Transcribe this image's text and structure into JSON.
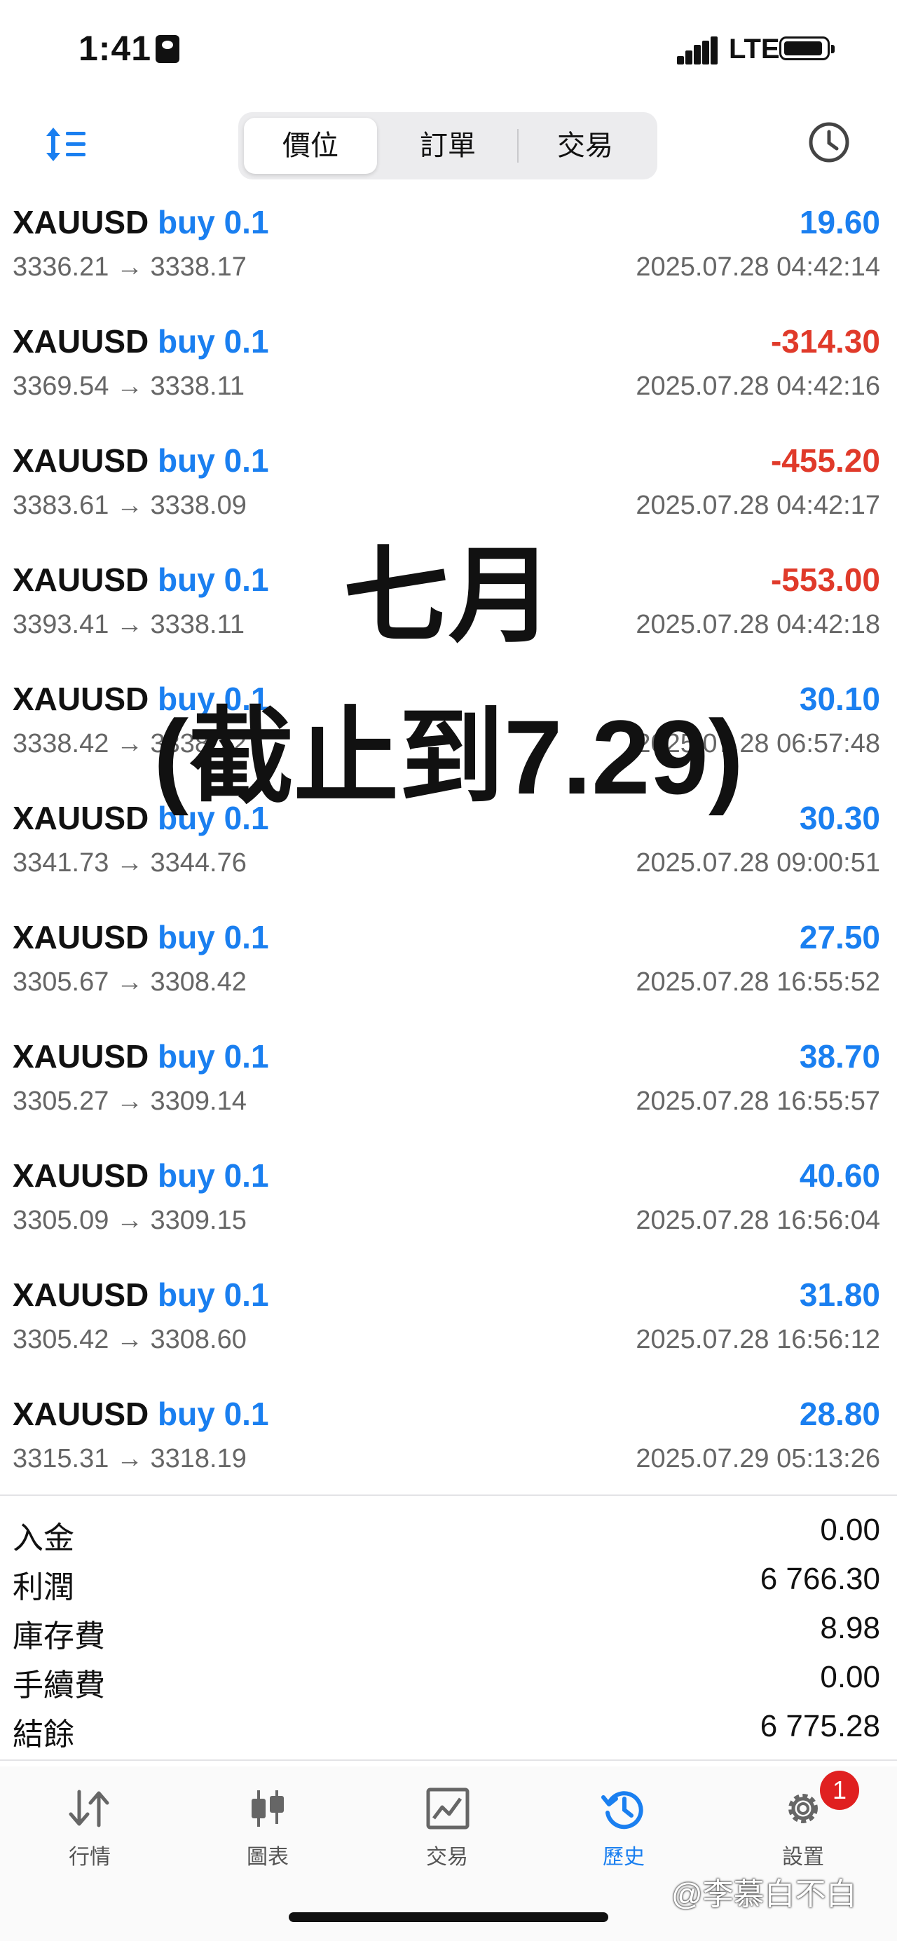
{
  "status_bar": {
    "time": "1:41",
    "network": "LTE"
  },
  "toolbar": {
    "tabs": [
      {
        "label": "價位",
        "active": true
      },
      {
        "label": "訂單",
        "active": false
      },
      {
        "label": "交易",
        "active": false
      }
    ]
  },
  "colors": {
    "accent": "#1a7ff0",
    "loss": "#e03a2a",
    "profit": "#1a7ff0"
  },
  "trades": [
    {
      "symbol": "XAUUSD",
      "side": "buy 0.1",
      "open": "3336.21",
      "close": "3338.17",
      "profit": "19.60",
      "time": "2025.07.28 04:42:14",
      "loss": false
    },
    {
      "symbol": "XAUUSD",
      "side": "buy 0.1",
      "open": "3369.54",
      "close": "3338.11",
      "profit": "-314.30",
      "time": "2025.07.28 04:42:16",
      "loss": true
    },
    {
      "symbol": "XAUUSD",
      "side": "buy 0.1",
      "open": "3383.61",
      "close": "3338.09",
      "profit": "-455.20",
      "time": "2025.07.28 04:42:17",
      "loss": true
    },
    {
      "symbol": "XAUUSD",
      "side": "buy 0.1",
      "open": "3393.41",
      "close": "3338.11",
      "profit": "-553.00",
      "time": "2025.07.28 04:42:18",
      "loss": true
    },
    {
      "symbol": "XAUUSD",
      "side": "buy 0.1",
      "open": "3338.42",
      "close": "3338.72",
      "profit": "30.10",
      "time": "2025.07.28 06:57:48",
      "loss": false
    },
    {
      "symbol": "XAUUSD",
      "side": "buy 0.1",
      "open": "3341.73",
      "close": "3344.76",
      "profit": "30.30",
      "time": "2025.07.28 09:00:51",
      "loss": false
    },
    {
      "symbol": "XAUUSD",
      "side": "buy 0.1",
      "open": "3305.67",
      "close": "3308.42",
      "profit": "27.50",
      "time": "2025.07.28 16:55:52",
      "loss": false
    },
    {
      "symbol": "XAUUSD",
      "side": "buy 0.1",
      "open": "3305.27",
      "close": "3309.14",
      "profit": "38.70",
      "time": "2025.07.28 16:55:57",
      "loss": false
    },
    {
      "symbol": "XAUUSD",
      "side": "buy 0.1",
      "open": "3305.09",
      "close": "3309.15",
      "profit": "40.60",
      "time": "2025.07.28 16:56:04",
      "loss": false
    },
    {
      "symbol": "XAUUSD",
      "side": "buy 0.1",
      "open": "3305.42",
      "close": "3308.60",
      "profit": "31.80",
      "time": "2025.07.28 16:56:12",
      "loss": false
    },
    {
      "symbol": "XAUUSD",
      "side": "buy 0.1",
      "open": "3315.31",
      "close": "3318.19",
      "profit": "28.80",
      "time": "2025.07.29 05:13:26",
      "loss": false
    }
  ],
  "overlay": {
    "line1": "七月",
    "line2": "(截止到7.29)"
  },
  "summary": [
    {
      "label": "入金",
      "value": "0.00"
    },
    {
      "label": "利潤",
      "value": "6 766.30"
    },
    {
      "label": "庫存費",
      "value": "8.98"
    },
    {
      "label": "手續費",
      "value": "0.00"
    },
    {
      "label": "結餘",
      "value": "6 775.28"
    }
  ],
  "tabbar": {
    "items": [
      {
        "label": "行情",
        "icon": "arrows-updown-icon",
        "active": false
      },
      {
        "label": "圖表",
        "icon": "candlestick-icon",
        "active": false
      },
      {
        "label": "交易",
        "icon": "line-chart-icon",
        "active": false
      },
      {
        "label": "歷史",
        "icon": "history-clock-icon",
        "active": true
      },
      {
        "label": "設置",
        "icon": "gear-icon",
        "active": false
      }
    ],
    "settings_badge": "1"
  },
  "watermark": "@李慕白不白"
}
